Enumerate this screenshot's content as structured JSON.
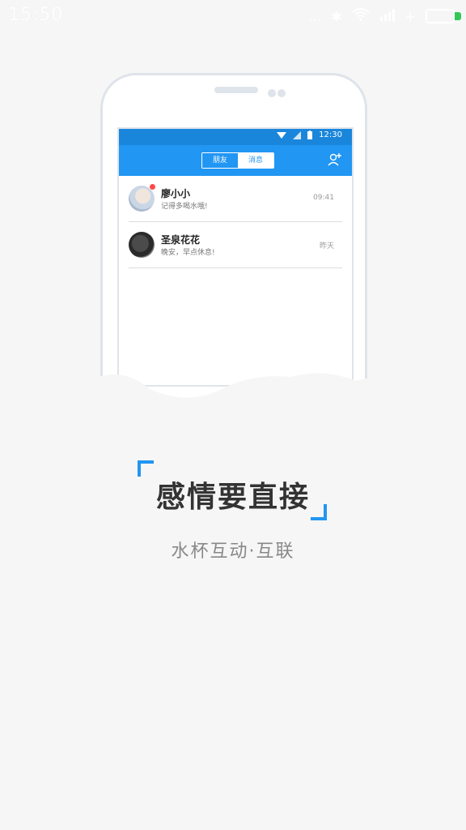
{
  "device_status": {
    "time": "15:50",
    "icons": [
      "signal-dots-icon",
      "bluetooth-icon",
      "wifi-icon",
      "cell-signal-icon",
      "charging-icon",
      "battery-icon"
    ]
  },
  "phone_illustration": {
    "status_bar": {
      "time": "12:30"
    },
    "tabs": [
      {
        "label": "朋友"
      },
      {
        "label": "消息"
      }
    ],
    "messages": [
      {
        "name": "廖小小",
        "text": "记得多喝水哦!",
        "time": "09:41",
        "unread": true
      },
      {
        "name": "圣泉花花",
        "text": "晚安，早点休息!",
        "time": "昨天",
        "unread": false
      }
    ]
  },
  "headline": "感情要直接",
  "subline": "水杯互动·互联",
  "colors": {
    "accent": "#2196f3",
    "header": "#2196f3",
    "background": "#f6f6f6",
    "unread": "#ff4a4a"
  }
}
